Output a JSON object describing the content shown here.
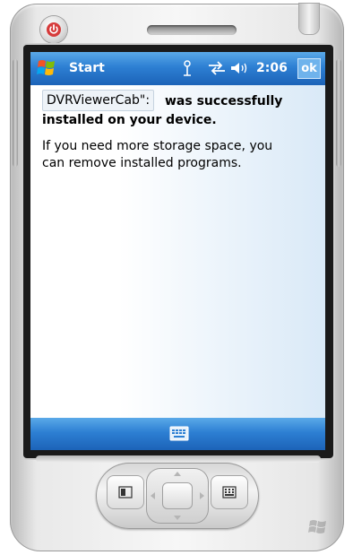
{
  "device": {
    "power_icon": "power-icon",
    "logo_icon": "windows-flag-icon"
  },
  "topbar": {
    "start_label": "Start",
    "time": "2:06",
    "ok_label": "ok",
    "icons": [
      "windows-flag-icon",
      "antenna-icon",
      "sync-icon",
      "volume-icon"
    ]
  },
  "message": {
    "app_name": "DVRViewerCab\":",
    "success_line1": "was successfully",
    "success_line2": "installed on your device.",
    "info_line1": "If you need more storage space, you",
    "info_line2": "can remove installed programs."
  },
  "bottombar": {
    "keyboard_icon": "keyboard-icon"
  },
  "colors": {
    "bar_blue": "#2d7fd3",
    "ok_button": "#6fb3ec",
    "content_tint": "#d9e9f7"
  }
}
